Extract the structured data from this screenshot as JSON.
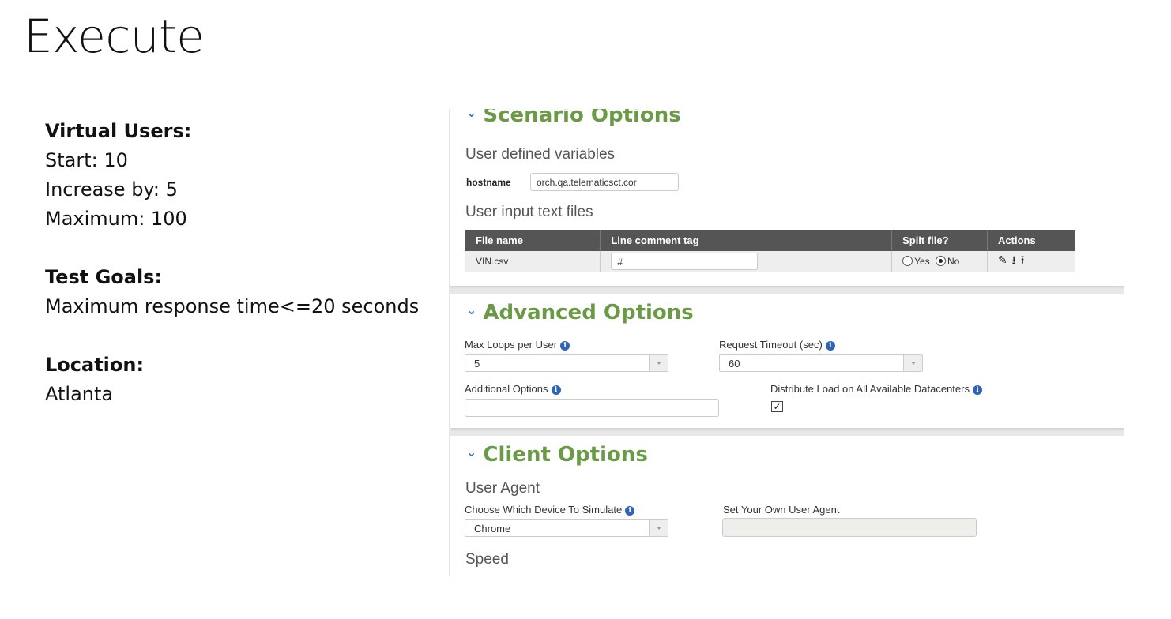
{
  "slide": {
    "title": "Execute",
    "virtual_users_heading": "Virtual Users:",
    "start": "Start: 10",
    "increase": "Increase by: 5",
    "maximum": "Maximum: 100",
    "test_goals_heading": "Test Goals:",
    "test_goal": "Maximum response time<=20 seconds",
    "location_heading": "Location:",
    "location": "Atlanta"
  },
  "scenario": {
    "title": "Scenario Options",
    "udv_heading": "User defined variables",
    "hostname_label": "hostname",
    "hostname_value": "orch.qa.telematicsct.cor",
    "files_heading": "User input text files",
    "columns": [
      "File name",
      "Line comment tag",
      "Split file?",
      "Actions"
    ],
    "file_name": "VIN.csv",
    "comment_tag": "#",
    "split_yes": "Yes",
    "split_no": "No",
    "split_selected": "No",
    "action_icons": [
      "edit-icon",
      "download-icon",
      "upload-icon"
    ]
  },
  "advanced": {
    "title": "Advanced Options",
    "max_loops_label": "Max Loops per User",
    "max_loops_value": "5",
    "timeout_label": "Request Timeout (sec)",
    "timeout_value": "60",
    "additional_label": "Additional Options",
    "additional_value": "",
    "distribute_label": "Distribute Load on All Available Datacenters",
    "distribute_checked": true
  },
  "client": {
    "title": "Client Options",
    "user_agent_heading": "User Agent",
    "device_label": "Choose Which Device To Simulate",
    "device_value": "Chrome",
    "own_agent_label": "Set Your Own User Agent",
    "own_agent_value": "",
    "speed_heading": "Speed"
  },
  "colors": {
    "section_title": "#6a9a45",
    "chevron": "#3b78c0",
    "table_header": "#555555",
    "info_icon": "#2f64b4"
  }
}
